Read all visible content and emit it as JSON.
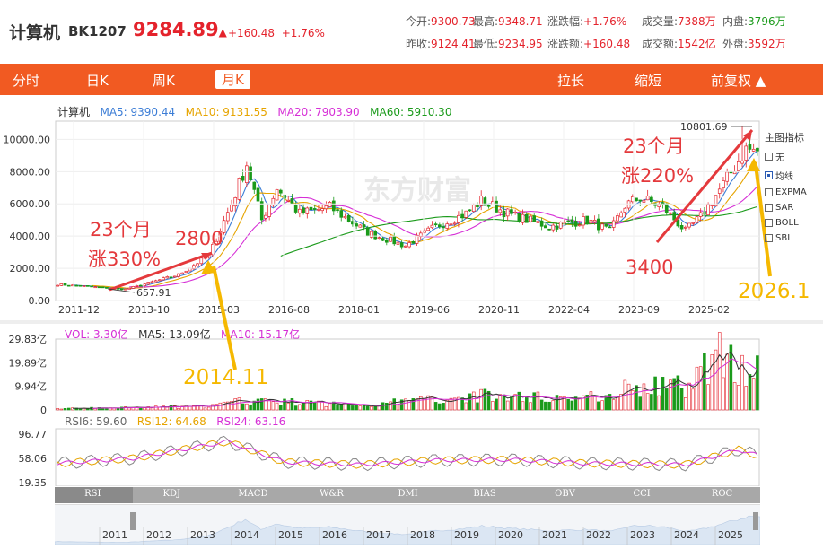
{
  "header": {
    "name": "计算机",
    "code": "BK1207",
    "price": "9284.89",
    "price_arrow": "▲",
    "change": "+160.48",
    "change_pct": "+1.76%",
    "stats_row1": [
      {
        "label": "今开:",
        "value": "9300.73"
      },
      {
        "label": "最高:",
        "value": "9348.71"
      },
      {
        "label": "涨跌幅:",
        "value": "+1.76%"
      },
      {
        "label": "成交量:",
        "value": "7388万"
      },
      {
        "label": "内盘:",
        "value": "3796万"
      }
    ],
    "stats_row2": [
      {
        "label": "昨收:",
        "value": "9124.41"
      },
      {
        "label": "最低:",
        "value": "9234.95"
      },
      {
        "label": "涨跌额:",
        "value": "+160.48"
      },
      {
        "label": "成交额:",
        "value": "1542亿"
      },
      {
        "label": "外盘:",
        "value": "3592万"
      }
    ]
  },
  "tabs": {
    "left": [
      "分时",
      "日K",
      "周K",
      "月K"
    ],
    "active": "月K",
    "right": [
      "拉长",
      "缩短",
      "前复权 ▲"
    ]
  },
  "legend": {
    "name": "计算机",
    "ma5": "MA5: 9390.44",
    "ma10": "MA10: 9131.55",
    "ma20": "MA20: 7903.90",
    "ma60": "MA60: 5910.30"
  },
  "volume_legend": {
    "vol": "VOL: 3.30亿",
    "ma5": "MA5: 13.09亿",
    "ma10": "MA10: 15.17亿"
  },
  "rsi_legend": {
    "rsi6": "RSI6: 59.60",
    "rsi12": "RSI12: 64.68",
    "rsi24": "RSI24: 63.16"
  },
  "side_panel": {
    "title": "主图指标",
    "items": [
      {
        "label": "无",
        "checked": false
      },
      {
        "label": "均线",
        "checked": true
      },
      {
        "label": "EXPMA",
        "checked": false
      },
      {
        "label": "SAR",
        "checked": false
      },
      {
        "label": "BOLL",
        "checked": false
      },
      {
        "label": "SBI",
        "checked": false
      }
    ]
  },
  "bottom_tabs": [
    "RSI",
    "KDJ",
    "MACD",
    "W&R",
    "DMI",
    "BIAS",
    "OBV",
    "CCI",
    "ROC"
  ],
  "navigator_years": [
    "2011",
    "2012",
    "2013",
    "2014",
    "2015",
    "2016",
    "2017",
    "2018",
    "2019",
    "2020",
    "2021",
    "2022",
    "2023",
    "2024",
    "2025"
  ],
  "watermark": "东方财富",
  "annotations": {
    "left_top": "23个月",
    "left_bottom": "涨330%",
    "left_price": "2800",
    "left_date": "2014.11",
    "right_top": "23个月",
    "right_bottom": "涨220%",
    "right_low": "3400",
    "right_date": "2026.1",
    "high_label": "10801.69",
    "low_label": "657.91"
  },
  "colors": {
    "up": "#e4232c",
    "down": "#1a9a1a",
    "ma5": "#3c7dd6",
    "ma10": "#e6a400",
    "ma20": "#d62fd6",
    "ma60": "#1a9a1a",
    "tabbar": "#f15a22",
    "annotation_red": "#e4393c",
    "annotation_yellow": "#f5b800"
  },
  "chart_data": {
    "type": "candlestick",
    "title": "计算机 BK1207 月K",
    "x_ticks": [
      "2011-12",
      "2013-10",
      "2015-03",
      "2016-08",
      "2018-01",
      "2019-06",
      "2020-11",
      "2022-04",
      "2023-09",
      "2025-02"
    ],
    "y_ticks": [
      "10000.00",
      "8000.00",
      "6000.00",
      "4000.00",
      "2000.00",
      "0.00"
    ],
    "ylim": [
      0,
      10801.69
    ],
    "volume_y_ticks": [
      "29.83亿",
      "19.89亿",
      "9.94亿",
      "0"
    ],
    "volume_ylim": [
      0,
      29.83
    ],
    "rsi_y_ticks": [
      "96.77",
      "58.06",
      "19.35"
    ],
    "rsi_ylim": [
      19.35,
      96.77
    ],
    "close_anchors": [
      {
        "t": 0,
        "v": 1000
      },
      {
        "t": 18,
        "v": 700
      },
      {
        "t": 32,
        "v": 1600
      },
      {
        "t": 40,
        "v": 2800
      },
      {
        "t": 46,
        "v": 6000
      },
      {
        "t": 50,
        "v": 8500
      },
      {
        "t": 54,
        "v": 5000
      },
      {
        "t": 58,
        "v": 7000
      },
      {
        "t": 64,
        "v": 5400
      },
      {
        "t": 72,
        "v": 5800
      },
      {
        "t": 82,
        "v": 4200
      },
      {
        "t": 92,
        "v": 3400
      },
      {
        "t": 100,
        "v": 4600
      },
      {
        "t": 108,
        "v": 5400
      },
      {
        "t": 112,
        "v": 6200
      },
      {
        "t": 120,
        "v": 5300
      },
      {
        "t": 130,
        "v": 4600
      },
      {
        "t": 140,
        "v": 5000
      },
      {
        "t": 146,
        "v": 4300
      },
      {
        "t": 150,
        "v": 5900
      },
      {
        "t": 154,
        "v": 6400
      },
      {
        "t": 160,
        "v": 5800
      },
      {
        "t": 166,
        "v": 4300
      },
      {
        "t": 170,
        "v": 5200
      },
      {
        "t": 176,
        "v": 7200
      },
      {
        "t": 182,
        "v": 9400
      },
      {
        "t": 185,
        "v": 9285
      }
    ],
    "volume_anchors": [
      {
        "t": 0,
        "v": 0.5
      },
      {
        "t": 40,
        "v": 1.5
      },
      {
        "t": 50,
        "v": 4
      },
      {
        "t": 80,
        "v": 2
      },
      {
        "t": 110,
        "v": 6
      },
      {
        "t": 140,
        "v": 5
      },
      {
        "t": 150,
        "v": 9
      },
      {
        "t": 166,
        "v": 10
      },
      {
        "t": 176,
        "v": 24
      },
      {
        "t": 185,
        "v": 16
      }
    ],
    "rsi_anchors": [
      {
        "t": 0,
        "v": 50
      },
      {
        "t": 20,
        "v": 58
      },
      {
        "t": 45,
        "v": 85
      },
      {
        "t": 60,
        "v": 52
      },
      {
        "t": 80,
        "v": 48
      },
      {
        "t": 100,
        "v": 55
      },
      {
        "t": 120,
        "v": 56
      },
      {
        "t": 140,
        "v": 50
      },
      {
        "t": 166,
        "v": 48
      },
      {
        "t": 180,
        "v": 72
      },
      {
        "t": 185,
        "v": 63
      }
    ]
  }
}
